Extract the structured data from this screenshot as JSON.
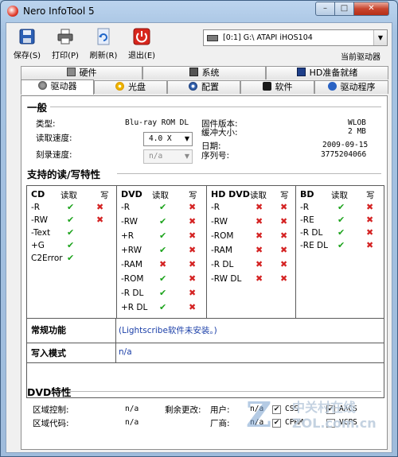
{
  "window": {
    "title": "Nero InfoTool 5",
    "min_label": "–",
    "max_label": "□",
    "close_label": "✕"
  },
  "toolbar": {
    "save": "保存(S)",
    "print": "打印(P)",
    "refresh": "刷新(R)",
    "exit": "退出(E)",
    "drive_select": "[0:1]  G:\\ ATAPI    iHOS104",
    "current_drive_label": "当前驱动器"
  },
  "tabs": {
    "row1": [
      "硬件",
      "系统",
      "HD准备就绪"
    ],
    "row2": [
      "驱动器",
      "光盘",
      "配置",
      "软件",
      "驱动程序"
    ]
  },
  "general": {
    "title": "一般",
    "type_label": "类型:",
    "type_value": "Blu-ray ROM DL",
    "read_speed_label": "读取速度:",
    "read_speed_value": "4.0 X",
    "write_speed_label": "刻录速度:",
    "write_speed_value": "n/a",
    "firmware_label": "固件版本:",
    "firmware_value": "WLOB",
    "buffer_label": "缓冲大小:",
    "buffer_value": "2 MB",
    "date_label": "日期:",
    "date_value": "2009-09-15",
    "serial_label": "序列号:",
    "serial_value": "3775204066"
  },
  "features": {
    "title": "支持的读/写特性",
    "cd": {
      "name": "CD",
      "read": "读取",
      "write": "写",
      "rows": [
        "-R",
        "-RW",
        "-Text",
        "+G",
        "C2Error"
      ]
    },
    "dvd": {
      "name": "DVD",
      "read": "读取",
      "write": "写",
      "rows": [
        "-R",
        "-RW",
        "+R",
        "+RW",
        "-RAM",
        "-ROM",
        "-R DL",
        "+R DL"
      ]
    },
    "hddvd": {
      "name": "HD DVD",
      "read": "读取",
      "write": "写",
      "rows": [
        "-R",
        "-RW",
        "-ROM",
        "-RAM",
        "-R DL",
        "-RW DL"
      ]
    },
    "bd": {
      "name": "BD",
      "read": "读取",
      "write": "写",
      "rows": [
        "-R",
        "-RE",
        "-R DL",
        "-RE DL"
      ]
    },
    "common_label": "常规功能",
    "common_value": "(Lightscribe软件未安装。)",
    "write_mode_label": "写入模式",
    "write_mode_value": "n/a"
  },
  "dvd_features": {
    "title": "DVD特性",
    "region_control_label": "区域控制:",
    "region_control_value": "n/a",
    "remaining_label": "剩余更改:",
    "user_label": "用户:",
    "user_value": "n/a",
    "region_code_label": "区域代码:",
    "region_code_value": "n/a",
    "vendor_label": "厂商:",
    "vendor_value": "n/a",
    "css": "CSS",
    "aacs": "AACS",
    "cprm": "CPRM",
    "vcps": "VCPS"
  },
  "watermark": {
    "line1": "中关村在线",
    "line2": "ZOL.com.cn"
  },
  "glyphs": {
    "check": "✔",
    "cross": "✖",
    "box_checked": "✔",
    "dropdown": "▼"
  }
}
